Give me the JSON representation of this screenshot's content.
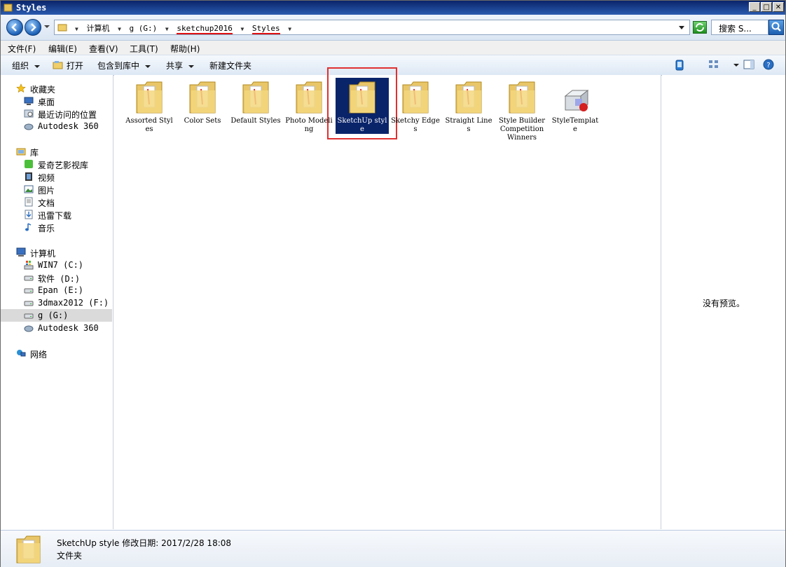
{
  "window": {
    "title": "Styles",
    "minimize": "_",
    "maximize": "□",
    "close": "✕"
  },
  "address": {
    "crumbs": [
      "计算机",
      "g (G:)",
      "sketchup2016",
      "Styles"
    ],
    "search_placeholder": "搜索 S..."
  },
  "menubar": [
    "文件(F)",
    "编辑(E)",
    "查看(V)",
    "工具(T)",
    "帮助(H)"
  ],
  "toolbar": {
    "organize": "组织",
    "open": "打开",
    "include_library": "包含到库中",
    "share": "共享",
    "new_folder": "新建文件夹"
  },
  "nav": {
    "favorites": {
      "label": "收藏夹",
      "items": [
        "桌面",
        "最近访问的位置",
        "Autodesk 360"
      ]
    },
    "libraries": {
      "label": "库",
      "items": [
        "爱奇艺影视库",
        "视频",
        "图片",
        "文档",
        "迅雷下载",
        "音乐"
      ]
    },
    "computer": {
      "label": "计算机",
      "items": [
        "WIN7 (C:)",
        "软件 (D:)",
        "Epan (E:)",
        "3dmax2012 (F:)",
        "g (G:)",
        "Autodesk 360"
      ]
    },
    "network": {
      "label": "网络"
    }
  },
  "files": [
    {
      "name": "Assorted Styles"
    },
    {
      "name": "Color Sets"
    },
    {
      "name": "Default Styles"
    },
    {
      "name": "Photo Modeling"
    },
    {
      "name": "SketchUp style"
    },
    {
      "name": "Sketchy Edges"
    },
    {
      "name": "Straight Lines"
    },
    {
      "name": "Style Builder Competition Winners"
    },
    {
      "name": "StyleTemplate"
    }
  ],
  "preview": {
    "empty_text": "没有预览。"
  },
  "details": {
    "name_line": "SketchUp style 修改日期: 2017/2/28 18:08",
    "type": "文件夹"
  }
}
